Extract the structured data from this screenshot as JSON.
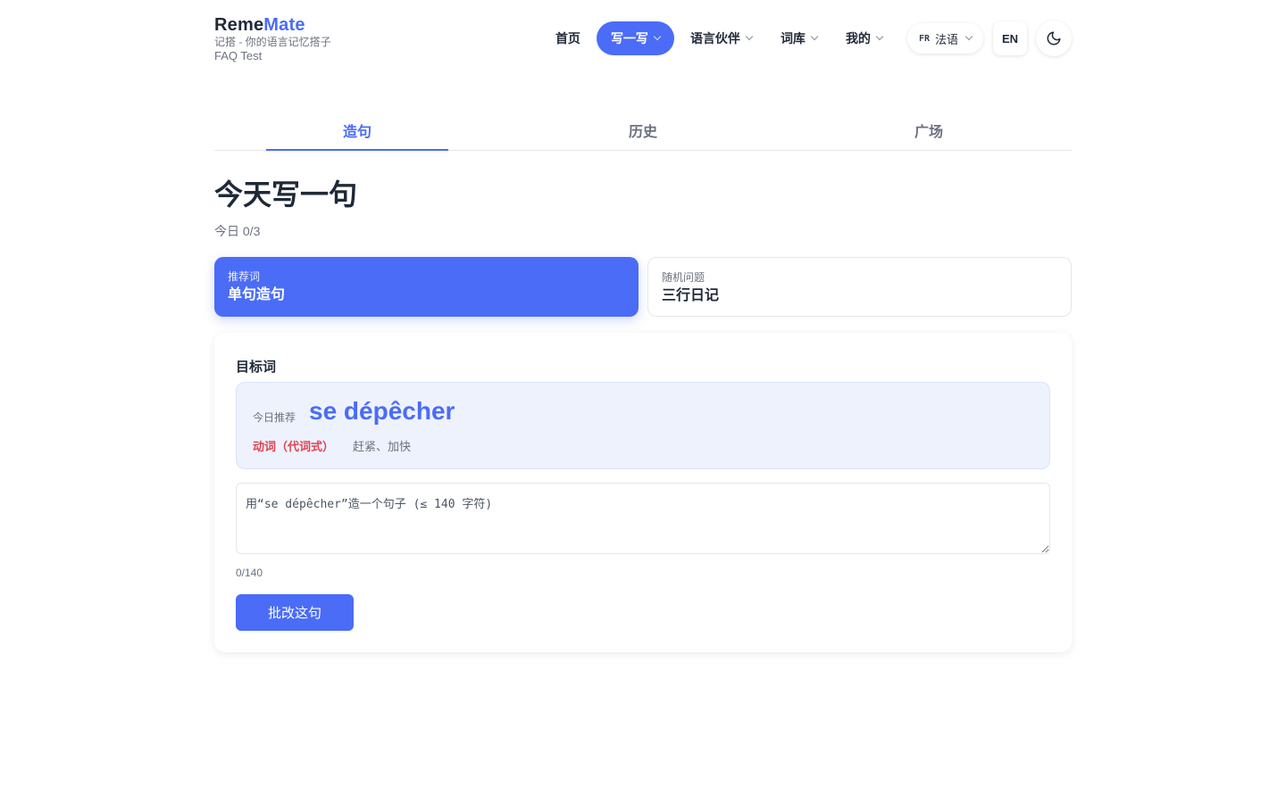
{
  "brand": {
    "name_part1": "Reme",
    "name_part2": "Mate",
    "subtitle": "记搭 - 你的语言记忆搭子",
    "env": "FAQ Test",
    "accent_color": "#4a6cf7"
  },
  "nav": {
    "items": [
      {
        "label": "首页",
        "active": false,
        "has_dropdown": false
      },
      {
        "label": "写一写",
        "active": true,
        "has_dropdown": true
      },
      {
        "label": "语言伙伴",
        "active": false,
        "has_dropdown": true
      },
      {
        "label": "词库",
        "active": false,
        "has_dropdown": true
      },
      {
        "label": "我的",
        "active": false,
        "has_dropdown": true
      }
    ],
    "language": {
      "code": "FR",
      "label": "法语"
    },
    "ui_language_button": "EN",
    "theme_icon": "moon-icon"
  },
  "tabs": [
    {
      "label": "造句",
      "active": true
    },
    {
      "label": "历史",
      "active": false
    },
    {
      "label": "广场",
      "active": false
    }
  ],
  "main": {
    "title": "今天写一句",
    "today_count": "今日 0/3"
  },
  "modes": [
    {
      "kicker": "推荐词",
      "title": "单句造句",
      "active": true
    },
    {
      "kicker": "随机问题",
      "title": "三行日记",
      "active": false
    }
  ],
  "target": {
    "label": "目标词",
    "kicker": "今日推荐",
    "word": "se dépêcher",
    "pos": "动词（代词式）",
    "meaning": "赶紧、加快"
  },
  "editor": {
    "placeholder": "用“se dépêcher”造一个句子 (≤ 140 字符)",
    "value": "",
    "count": "0/140",
    "submit_label": "批改这句"
  }
}
